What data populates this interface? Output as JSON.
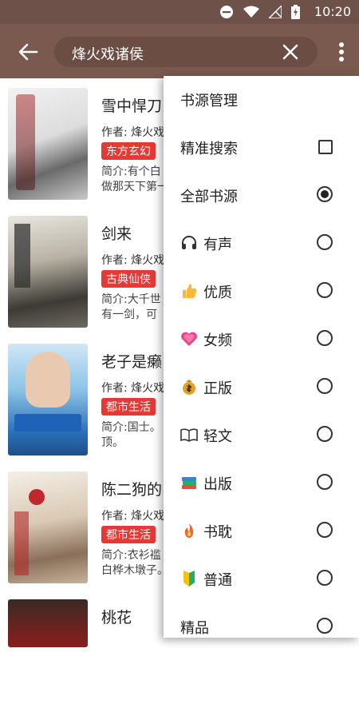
{
  "status_bar": {
    "time": "10:20"
  },
  "app_bar": {
    "search_query": "烽火戏诸侯",
    "back_icon": "arrow-left-icon",
    "clear_icon": "close-icon",
    "more_icon": "more-vert-icon"
  },
  "books": [
    {
      "title": "雪中悍刀",
      "author": "作者: 烽火戏",
      "tag": "东方玄幻",
      "intro1": "简介:有个白",
      "intro2": "做那天下第一"
    },
    {
      "title": "剑来",
      "author": "作者: 烽火戏",
      "tag": "古典仙侠",
      "intro1": "简介:大千世",
      "intro2": "有一剑，可"
    },
    {
      "title": "老子是癞",
      "author": "作者: 烽火戏",
      "tag": "都市生活",
      "intro1": "简介:国士。",
      "intro2": "顶。"
    },
    {
      "title": "陈二狗的",
      "author": "作者: 烽火戏",
      "tag": "都市生活",
      "intro1": "简介:衣衫褴",
      "intro2": "白桦木墩子。"
    },
    {
      "title": "桃花",
      "author": "",
      "tag": "",
      "intro1": "",
      "intro2": ""
    }
  ],
  "menu": {
    "source_manage": "书源管理",
    "exact_search": "精准搜索",
    "all_sources": "全部书源",
    "groups": [
      {
        "label": "有声",
        "icon": "headphones-icon"
      },
      {
        "label": "优质",
        "icon": "thumbs-up-icon"
      },
      {
        "label": "女频",
        "icon": "heart-icon"
      },
      {
        "label": "正版",
        "icon": "money-bag-icon"
      },
      {
        "label": "轻文",
        "icon": "open-book-icon"
      },
      {
        "label": "出版",
        "icon": "books-icon"
      },
      {
        "label": "书耽",
        "icon": "fire-icon"
      },
      {
        "label": "普通",
        "icon": "beginner-icon"
      },
      {
        "label": "精品",
        "icon": ""
      }
    ]
  },
  "colors": {
    "app_bar": "#7a5a4e",
    "status_bar": "#6e5148",
    "tag": "#e53935"
  }
}
